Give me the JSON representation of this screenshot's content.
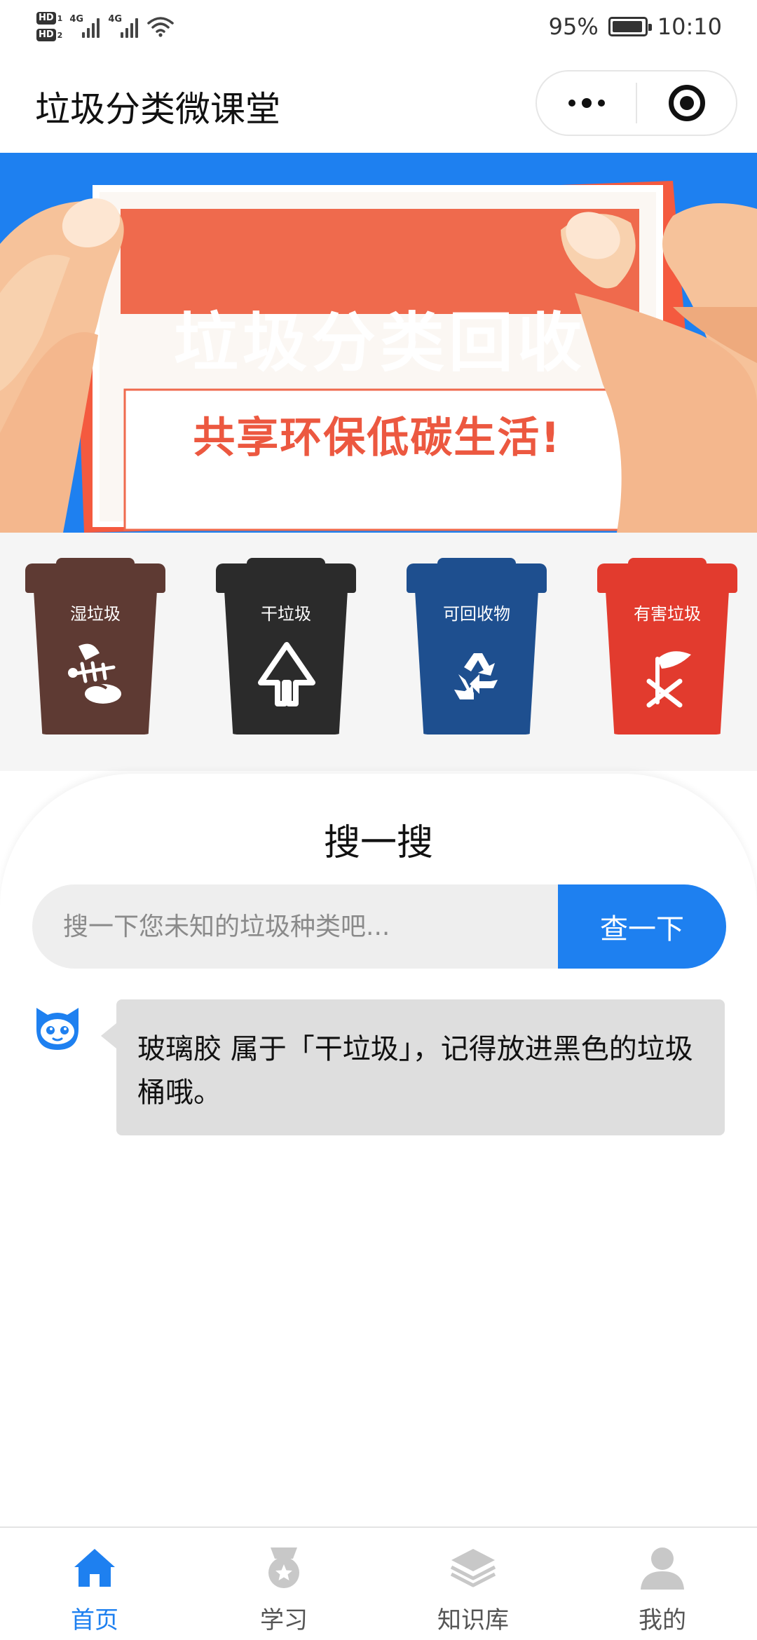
{
  "status_bar": {
    "hd1": "HD",
    "hd1_num": "1",
    "hd2": "HD",
    "hd2_num": "2",
    "net1": "4G",
    "net2": "4G",
    "battery_percent": "95%",
    "battery_level": 0.95,
    "time": "10:10"
  },
  "header": {
    "title": "垃圾分类微课堂",
    "more_icon": "more-dots-icon",
    "close_icon": "target-circle-icon"
  },
  "banner": {
    "headline": "垃圾分类回收",
    "slogan": "共享环保低碳生活!",
    "background_color": "#1e80f0"
  },
  "bins": [
    {
      "label": "湿垃圾",
      "color": "#5e3a33",
      "icon": "fishbone-icon"
    },
    {
      "label": "干垃圾",
      "color": "#2b2b2b",
      "icon": "dry-waste-icon"
    },
    {
      "label": "可回收物",
      "color": "#1e4f8f",
      "icon": "recycle-icon"
    },
    {
      "label": "有害垃圾",
      "color": "#e23b2e",
      "icon": "hazard-icon"
    }
  ],
  "search": {
    "title": "搜一搜",
    "placeholder": "搜一下您未知的垃圾种类吧...",
    "button_label": "查一下",
    "accent_color": "#1e80f0"
  },
  "result": {
    "message": "玻璃胶 属于「干垃圾」，记得放进黑色的垃圾桶哦。"
  },
  "tabs": [
    {
      "label": "首页",
      "icon": "home-icon",
      "active": true
    },
    {
      "label": "学习",
      "icon": "medal-icon",
      "active": false
    },
    {
      "label": "知识库",
      "icon": "layers-icon",
      "active": false
    },
    {
      "label": "我的",
      "icon": "user-icon",
      "active": false
    }
  ]
}
